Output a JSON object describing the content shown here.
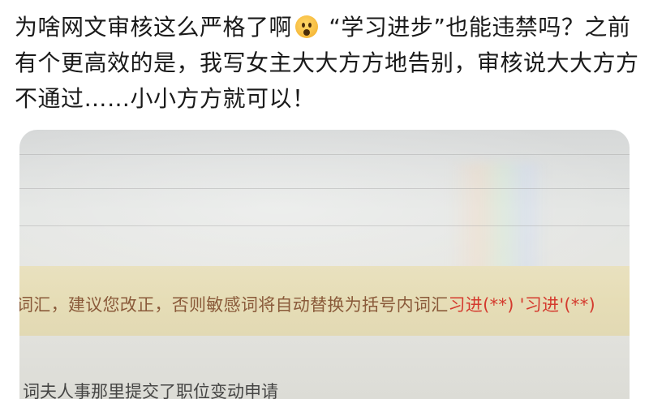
{
  "post": {
    "text_before_emoji": "为啥网文审核这么严格了啊",
    "emoji": "astonished-face-icon",
    "text_after_emoji": " “学习进步”也能违禁吗？之前有个更高效的是，我写女主大大方方地告别，审核说大大方方不通过……小小方方就可以！"
  },
  "screenshot": {
    "warning_prefix": "词汇，建议您改正，否则敏感词将自动替换为括号内词汇",
    "warning_term_1": "习进(**)",
    "warning_term_2": "'习进'(**)",
    "bottom_line": "词夫人事那里提交了职位变动申请"
  }
}
